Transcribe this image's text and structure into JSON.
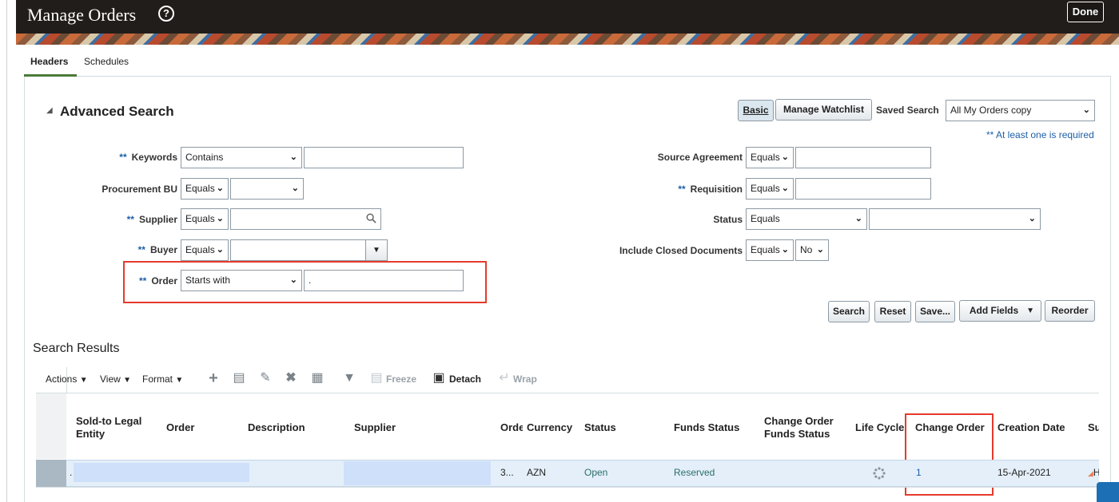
{
  "header": {
    "title": "Manage Orders",
    "help_icon": "question-circle-icon",
    "done_label": "Done"
  },
  "tabs": [
    {
      "label": "Headers",
      "active": true
    },
    {
      "label": "Schedules",
      "active": false
    }
  ],
  "advanced_search": {
    "title": "Advanced Search",
    "buttons": {
      "basic": "Basic",
      "manage_watchlist": "Manage Watchlist"
    },
    "saved_search_label": "Saved Search",
    "saved_search_value": "All My Orders copy",
    "required_note": "** At least one is required",
    "required_marker": "**",
    "fields": {
      "keywords": {
        "label": "Keywords",
        "operator": "Contains",
        "value": ""
      },
      "procurement_bu": {
        "label": "Procurement BU",
        "operator": "Equals",
        "value": ""
      },
      "supplier": {
        "label": "Supplier",
        "operator": "Equals",
        "value": ""
      },
      "buyer": {
        "label": "Buyer",
        "operator": "Equals",
        "value": ""
      },
      "order": {
        "label": "Order",
        "operator": "Starts with",
        "value": "."
      },
      "source_agreement": {
        "label": "Source Agreement",
        "operator": "Equals",
        "value": ""
      },
      "requisition": {
        "label": "Requisition",
        "operator": "Equals",
        "value": ""
      },
      "status": {
        "label": "Status",
        "operator": "Equals",
        "value": ""
      },
      "include_closed": {
        "label": "Include Closed Documents",
        "operator": "Equals",
        "value": "No"
      }
    },
    "actions": {
      "search": "Search",
      "reset": "Reset",
      "save": "Save...",
      "add_fields": "Add Fields",
      "reorder": "Reorder"
    }
  },
  "results": {
    "title": "Search Results",
    "toolbar": {
      "actions": "Actions",
      "view": "View",
      "format": "Format",
      "freeze": "Freeze",
      "detach": "Detach",
      "wrap": "Wrap"
    },
    "columns": [
      "Sold-to Legal Entity",
      "Order",
      "Description",
      "Supplier",
      "Orde",
      "Currency",
      "Status",
      "Funds Status",
      "Change Order Funds Status",
      "Life Cycle",
      "Change Order",
      "Creation Date",
      "Su"
    ],
    "rows": [
      {
        "sold_to": ".",
        "order_trunc": "3...",
        "currency": "AZN",
        "status": "Open",
        "funds_status": "Reserved",
        "change_order": "1",
        "creation_date": "15-Apr-2021",
        "su": "H"
      }
    ]
  },
  "colors": {
    "link": "#1d5fa6",
    "highlight": "#e53b2c",
    "row_selected": "#e4eff9"
  }
}
